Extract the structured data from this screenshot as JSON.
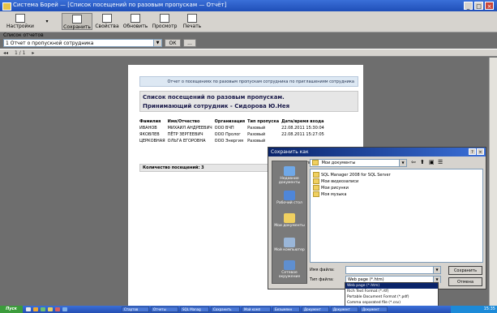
{
  "window": {
    "title": "Система Борей — [Список посещений по разовым пропускам — Отчёт]",
    "buttons": [
      "_",
      "□",
      "×"
    ]
  },
  "toolbar": {
    "items": [
      {
        "label": "Настройки"
      },
      {
        "label": "Сохранить"
      },
      {
        "label": "Свойства"
      },
      {
        "label": "Обновить"
      },
      {
        "label": "Просмотр"
      },
      {
        "label": "Печать"
      }
    ]
  },
  "report_selector": {
    "label": "Список отчетов",
    "value": "1 Отчет о пропускной сотрудника",
    "ok_label": "ОК",
    "extra_label": "..."
  },
  "navigator": {
    "text": "1 / 1"
  },
  "report": {
    "banner": "Отчет о посещениях по разовым пропускам сотрудника по приглашениям сотрудника",
    "title_line1": "Список посещений по разовым пропускам.",
    "title_line2": "Принимающий сотрудник - Сидорова Ю.Нея",
    "columns": [
      "Фамилия",
      "Имя/Отчество",
      "Организация",
      "Тип пропуска",
      "Дата/время входа"
    ],
    "rows": [
      [
        "ИВАНОВ",
        "МИХАИЛ АНДРЕЕВИЧ",
        "ООО ВЧП",
        "Разовый",
        "22.08.2011 15:30:04"
      ],
      [
        "ЯКОВЛЕВ",
        "ПЁТР ЗЕРГЕЕВИЧ",
        "ООО Пролог",
        "Разовый",
        "22.08.2011 15:27:05"
      ],
      [
        "ЦЕРКОВНАЯ",
        "ОЛЬГА ЕГОРОВНА",
        "ООО Энергия",
        "Разовый",
        ""
      ]
    ],
    "total": "Количество посещений: 3"
  },
  "save_dialog": {
    "title": "Сохранить как",
    "folder_label": "Папка:",
    "folder_value": "Мои документы",
    "places": [
      "Недавние документы",
      "Рабочий стол",
      "Мои документы",
      "Мой компьютер",
      "Сетевое окружение"
    ],
    "files": [
      "SQL Manager 2008 for SQL Server",
      "Мои видеозаписи",
      "Мои рисунки",
      "Моя музыка"
    ],
    "filename_label": "Имя файла:",
    "filename_value": "",
    "filetype_label": "Тип файла:",
    "filetype_value": "Web page (*.htm)",
    "save_label": "Сохранить",
    "cancel_label": "Отмена",
    "type_options": [
      "Web page (*.htm)",
      "Rich Text Format (*.rtf)",
      "Portable Document Format (*.pdf)",
      "Comma separated file (*.csv)"
    ],
    "selected_type_index": 0
  },
  "taskbar": {
    "start_label": "Пуск",
    "tasks": [
      "Стартов",
      "Отчеты",
      "SQL Manag",
      "Сохранить",
      "Мой комп",
      "Безымянн",
      "Документ",
      "Документ",
      "Документ"
    ],
    "clock": "15:35"
  }
}
